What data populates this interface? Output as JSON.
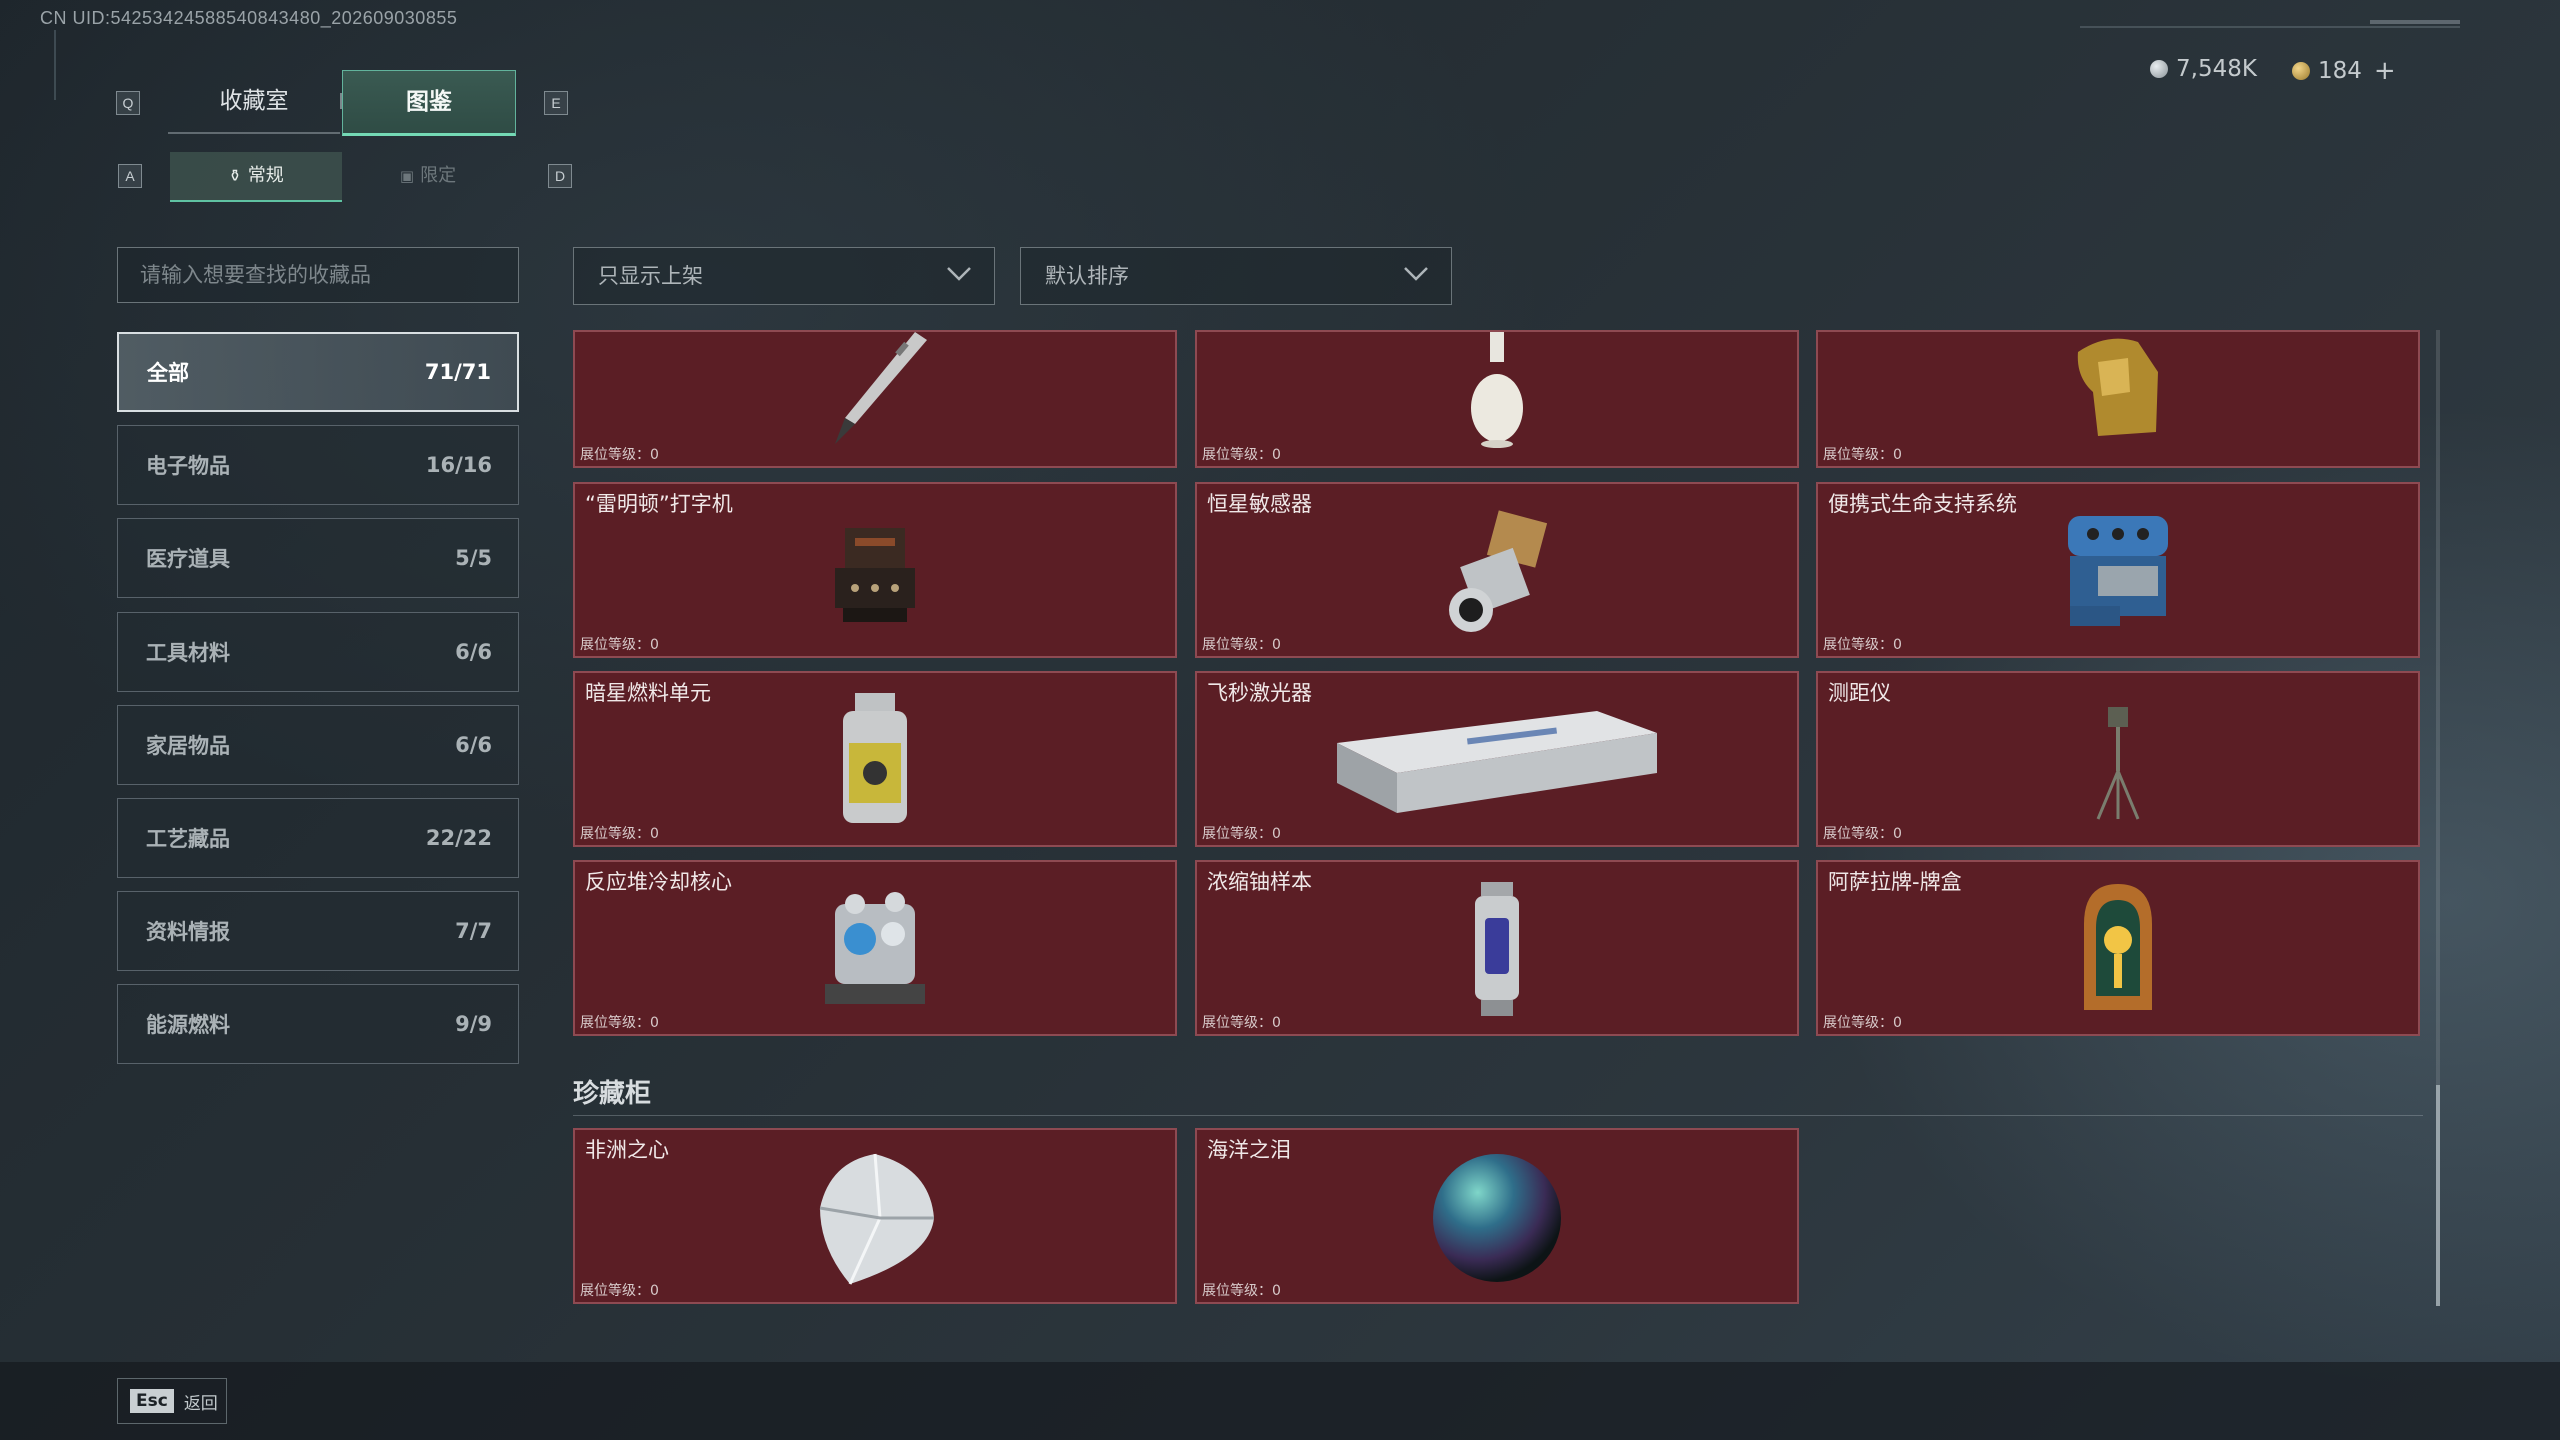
{
  "uid": "CN UID:54253424588540843480_202609030855",
  "hotkeys": {
    "q": "Q",
    "e": "E",
    "a": "A",
    "d": "D"
  },
  "tabs": [
    {
      "label": "收藏室"
    },
    {
      "label": "图鉴"
    }
  ],
  "subtabs": [
    {
      "label": "常规"
    },
    {
      "label": "限定"
    }
  ],
  "currency": {
    "silver": "7,548K",
    "gold": "184",
    "add": "+"
  },
  "search": {
    "placeholder": "请输入想要查找的收藏品"
  },
  "filters": {
    "display": "只显示上架",
    "sort": "默认排序"
  },
  "categories": [
    {
      "label": "全部",
      "count": "71/71"
    },
    {
      "label": "电子物品",
      "count": "16/16"
    },
    {
      "label": "医疗道具",
      "count": "5/5"
    },
    {
      "label": "工具材料",
      "count": "6/6"
    },
    {
      "label": "家居物品",
      "count": "6/6"
    },
    {
      "label": "工艺藏品",
      "count": "22/22"
    },
    {
      "label": "资料情报",
      "count": "7/7"
    },
    {
      "label": "能源燃料",
      "count": "9/9"
    }
  ],
  "level_label": "展位等级：0",
  "items": [
    {
      "name": "",
      "icon": "fountain-pen-icon"
    },
    {
      "name": "",
      "icon": "vase-icon"
    },
    {
      "name": "",
      "icon": "golden-statue-icon"
    },
    {
      "name": "“雷明顿”打字机",
      "icon": "typewriter-icon"
    },
    {
      "name": "恒星敏感器",
      "icon": "star-sensor-icon"
    },
    {
      "name": "便携式生命支持系统",
      "icon": "life-support-icon"
    },
    {
      "name": "暗星燃料单元",
      "icon": "fuel-cell-icon"
    },
    {
      "name": "飞秒激光器",
      "icon": "laser-device-icon"
    },
    {
      "name": "测距仪",
      "icon": "rangefinder-icon"
    },
    {
      "name": "反应堆冷却核心",
      "icon": "reactor-core-icon"
    },
    {
      "name": "浓缩铀样本",
      "icon": "uranium-sample-icon"
    },
    {
      "name": "阿萨拉牌-牌盒",
      "icon": "card-box-icon"
    }
  ],
  "treasure_section": {
    "title": "珍藏柜",
    "items": [
      {
        "name": "非洲之心",
        "icon": "diamond-icon"
      },
      {
        "name": "海洋之泪",
        "icon": "pearl-icon"
      }
    ]
  },
  "footer": {
    "esc_key": "Esc",
    "back": "返回"
  }
}
